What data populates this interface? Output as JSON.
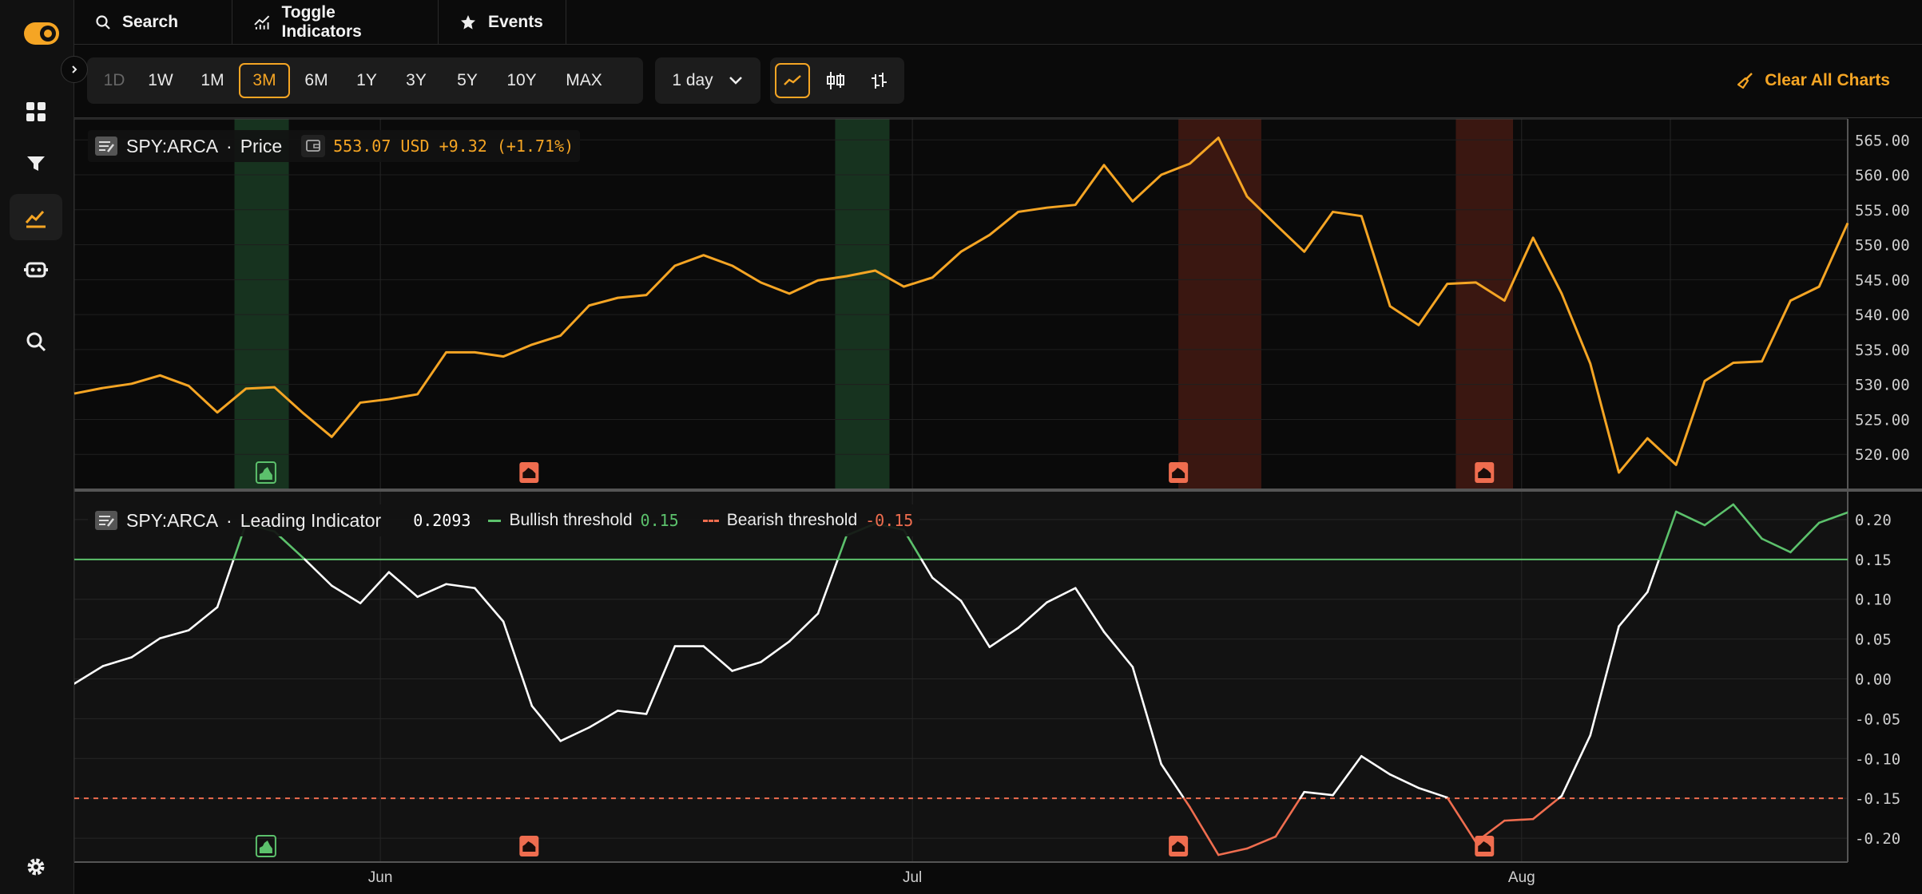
{
  "topbar": {
    "search": "Search",
    "toggle_indicators": "Toggle Indicators",
    "events": "Events"
  },
  "ranges": [
    "1D",
    "1W",
    "1M",
    "3M",
    "6M",
    "1Y",
    "3Y",
    "5Y",
    "10Y",
    "MAX"
  ],
  "selected_range": "3M",
  "interval": "1 day",
  "clear_all": "Clear All Charts",
  "colors": {
    "accent": "#f5a524",
    "bullish": "#5cc16c",
    "bearish": "#ef6d4f",
    "indicator": "#ffffff"
  },
  "legend_price": {
    "symbol": "SPY:ARCA",
    "sep": "·",
    "name": "Price",
    "value": "553.07 USD +9.32 (+1.71%)"
  },
  "legend_ind": {
    "symbol": "SPY:ARCA",
    "sep": "·",
    "name": "Leading Indicator",
    "value": "0.2093",
    "bull_label": "Bullish threshold",
    "bull_value": "0.15",
    "bear_label": "Bearish threshold",
    "bear_value": "-0.15"
  },
  "chart_data": [
    {
      "type": "line",
      "name": "Price",
      "ylim": [
        515,
        568
      ],
      "yticks": [
        "565.00",
        "560.00",
        "555.00",
        "550.00",
        "545.00",
        "540.00",
        "535.00",
        "530.00",
        "525.00",
        "520.00"
      ],
      "xticks": [
        {
          "label": "Jun",
          "index": 10.7
        },
        {
          "label": "Jul",
          "index": 29.3
        },
        {
          "label": "Aug",
          "index": 50.6
        }
      ],
      "values": [
        528.7,
        529.5,
        530.1,
        531.3,
        529.8,
        526.0,
        529.4,
        529.6,
        525.9,
        522.5,
        527.4,
        527.9,
        528.6,
        534.6,
        534.6,
        534.0,
        535.7,
        537.0,
        541.3,
        542.4,
        542.8,
        547.0,
        548.5,
        547.0,
        544.6,
        543.0,
        544.9,
        545.5,
        546.3,
        544.0,
        545.3,
        549.0,
        551.4,
        554.7,
        555.3,
        555.7,
        561.4,
        556.2,
        560.0,
        561.6,
        565.3,
        556.9,
        552.9,
        549.0,
        554.7,
        554.1,
        541.2,
        538.5,
        544.4,
        544.6,
        542.0,
        551.0,
        543.0,
        533.0,
        517.4,
        522.3,
        518.5,
        530.5,
        533.1,
        533.3,
        542.0,
        544.0,
        553.1
      ],
      "events": [
        {
          "type": "bullish",
          "start": 5.6,
          "end": 7.5,
          "icon": 6.7
        },
        {
          "type": "bearish",
          "icon": 15.9
        },
        {
          "type": "bullish",
          "start": 26.6,
          "end": 28.5
        },
        {
          "type": "bearish",
          "start": 38.6,
          "end": 41.5,
          "icon": 38.6
        },
        {
          "type": "bearish",
          "start": 48.3,
          "end": 50.3,
          "icon": 49.3
        }
      ]
    },
    {
      "type": "line",
      "name": "Leading Indicator",
      "ylim": [
        -0.23,
        0.235
      ],
      "yticks": [
        "0.20",
        "0.15",
        "0.10",
        "0.05",
        "0.00",
        "-0.05",
        "-0.10",
        "-0.15",
        "-0.20"
      ],
      "bull_threshold": 0.15,
      "bear_threshold": -0.15,
      "values": [
        -0.006,
        0.016,
        0.027,
        0.051,
        0.061,
        0.09,
        0.195,
        0.185,
        0.152,
        0.117,
        0.095,
        0.134,
        0.103,
        0.119,
        0.114,
        0.072,
        -0.034,
        -0.078,
        -0.061,
        -0.04,
        -0.044,
        0.041,
        0.041,
        0.01,
        0.021,
        0.047,
        0.082,
        0.18,
        0.195,
        0.187,
        0.127,
        0.098,
        0.04,
        0.064,
        0.096,
        0.114,
        0.059,
        0.015,
        -0.107,
        -0.161,
        -0.221,
        -0.213,
        -0.198,
        -0.142,
        -0.146,
        -0.097,
        -0.12,
        -0.137,
        -0.149,
        -0.205,
        -0.178,
        -0.176,
        -0.147,
        -0.071,
        0.066,
        0.109,
        0.21,
        0.193,
        0.219,
        0.176,
        0.159,
        0.196,
        0.209
      ]
    }
  ]
}
